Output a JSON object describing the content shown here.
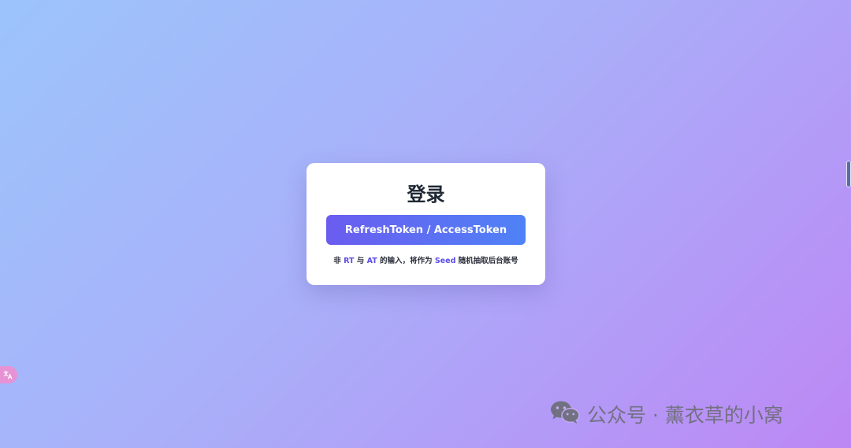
{
  "login": {
    "title": "登录",
    "token_button_label": "RefreshToken / AccessToken",
    "hint": {
      "prefix": "非 ",
      "rt": "RT",
      "and": " 与 ",
      "at": "AT",
      "middle": " 的输入，将作为 ",
      "seed": "Seed",
      "suffix": " 随机抽取后台账号"
    }
  },
  "watermark": {
    "text": "公众号 · 薰衣草的小窝",
    "icon": "wechat-icon"
  },
  "floating": {
    "translate_icon": "translate-icon"
  },
  "colors": {
    "accent": "#5b4de6",
    "button_start": "#6a5cef",
    "button_end": "#4f82f7",
    "title_text": "#1f2733"
  }
}
